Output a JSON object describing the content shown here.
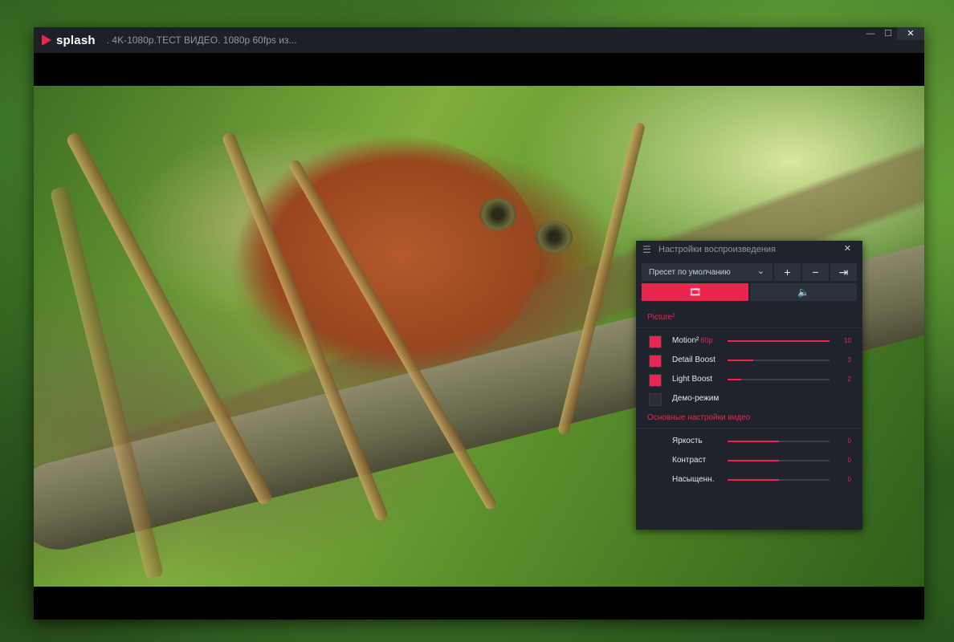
{
  "app": {
    "logo_text": "splash",
    "title": ". 4K-1080p.ТЕСТ ВИДЕО. 1080p 60fps из..."
  },
  "window_controls": {
    "minimize": "—",
    "maximize": "☐",
    "close": "✕"
  },
  "panel": {
    "title": "Настройки воспроизведения",
    "close": "✕",
    "preset": {
      "selected": "Пресет по умолчанию"
    },
    "preset_buttons": {
      "add": "+",
      "remove": "−",
      "move": "⇥"
    },
    "tabs": [
      {
        "icon": "film-icon",
        "active": true
      },
      {
        "icon": "speaker-icon",
        "active": false
      }
    ],
    "picture_section": {
      "title": "Picture²"
    },
    "picture_items": [
      {
        "label": "Motion²",
        "sublabel": "60p",
        "checked": true,
        "value": "10",
        "level": 1.0
      },
      {
        "label": "Detail Boost",
        "checked": true,
        "value": "3",
        "level": 0.25
      },
      {
        "label": "Light Boost",
        "checked": true,
        "value": "2",
        "level": 0.13
      },
      {
        "label": "Демо-режим",
        "checked": false
      }
    ],
    "video_section": {
      "title": "Основные настройки видео"
    },
    "video_items": [
      {
        "label": "Яркость",
        "value": "0",
        "level": 0.5
      },
      {
        "label": "Контраст",
        "value": "0",
        "level": 0.5
      },
      {
        "label": "Насыщенн.",
        "value": "0",
        "level": 0.5
      }
    ]
  },
  "colors": {
    "accent": "#e8264e",
    "panel_bg": "#1f242c",
    "titlebar_bg": "#1c2128"
  }
}
